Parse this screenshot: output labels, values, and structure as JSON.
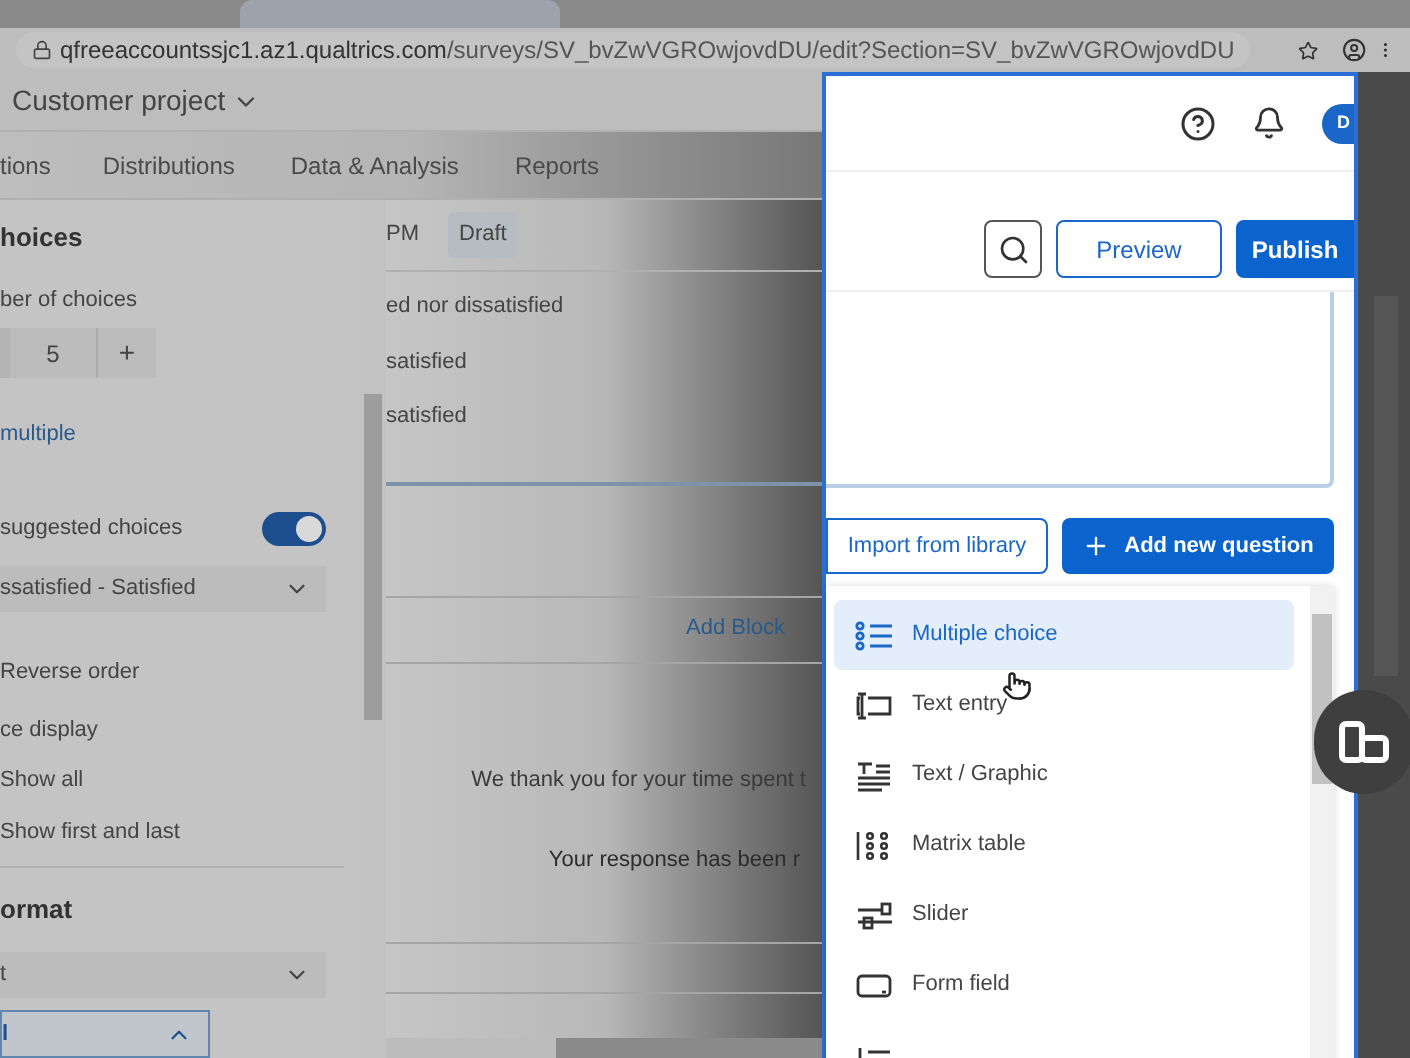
{
  "browser": {
    "url_domain": "qfreeaccountssjc1.az1.qualtrics.com",
    "url_path": "/surveys/SV_bvZwVGROwjovdDU/edit?Section=SV_bvZwVGROwjovdDU"
  },
  "project": {
    "title": "Customer project"
  },
  "nav_tabs": [
    {
      "label": "tions",
      "selected": false
    },
    {
      "label": "Distributions",
      "selected": false
    },
    {
      "label": "Data & Analysis",
      "selected": false
    },
    {
      "label": "Reports",
      "selected": false
    }
  ],
  "sidebar": {
    "choices_heading": "hoices",
    "count_label": "ber of choices",
    "count_value": "5",
    "count_plus": "+",
    "multiple_link": "multiple",
    "suggested": {
      "label": "suggested choices",
      "on": true
    },
    "scale_dropdown": "ssatisfied - Satisfied",
    "reverse_order": "Reverse order",
    "display_label": "ce display",
    "display_options": [
      "Show all",
      "Show first and last"
    ],
    "format_heading": "ormat",
    "format_dropdown": "t",
    "open_dropdown": "l"
  },
  "survey": {
    "timestamp": "PM",
    "status": "Draft",
    "choices": [
      "ed nor dissatisfied",
      "satisfied",
      "satisfied"
    ],
    "add_block": "Add Block",
    "end_lines": [
      "We thank you for your time spent t",
      "Your response has been r"
    ]
  },
  "panel": {
    "avatar": "D",
    "preview": "Preview",
    "publish": "Publish",
    "import": "Import from library",
    "add_question": "Add new question",
    "question_types": [
      {
        "label": "Multiple choice",
        "kind": "multiple",
        "selected": true
      },
      {
        "label": "Text entry",
        "kind": "text",
        "selected": false
      },
      {
        "label": "Text / Graphic",
        "kind": "graphic",
        "selected": false
      },
      {
        "label": "Matrix table",
        "kind": "matrix",
        "selected": false
      },
      {
        "label": "Slider",
        "kind": "slider",
        "selected": false
      },
      {
        "label": "Form field",
        "kind": "form",
        "selected": false
      },
      {
        "kind": "rank",
        "selected": false
      }
    ]
  }
}
